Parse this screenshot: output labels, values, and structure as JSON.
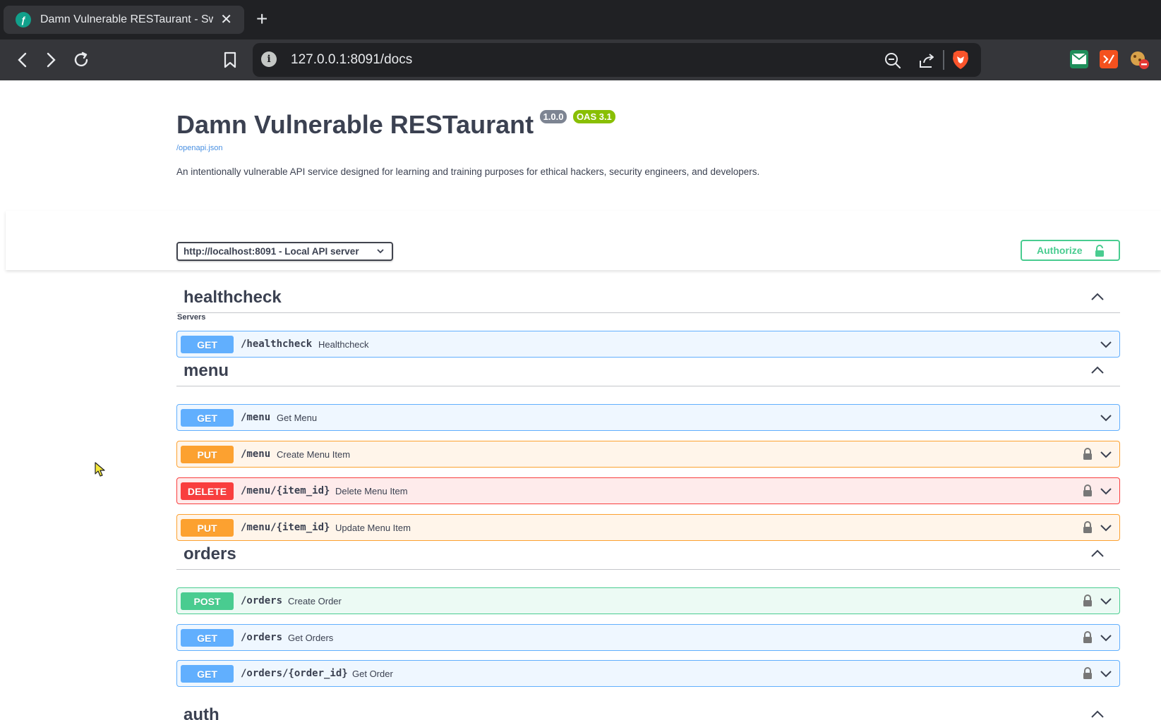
{
  "browser": {
    "tab_title": "Damn Vulnerable RESTaurant - Swagger UI",
    "url": "127.0.0.1:8091/docs"
  },
  "info": {
    "title": "Damn Vulnerable RESTaurant",
    "version": "1.0.0",
    "oas": "OAS 3.1",
    "spec_link": "/openapi.json",
    "description": "An intentionally vulnerable API service designed for learning and training purposes for ethical hackers, security engineers, and developers."
  },
  "servers": {
    "label": "Servers",
    "selected": "http://localhost:8091 - Local API server"
  },
  "authorize_label": "Authorize",
  "tags": [
    {
      "name": "healthcheck",
      "operations": [
        {
          "method": "GET",
          "path": "/healthcheck",
          "summary": "Healthcheck",
          "locked": false
        }
      ]
    },
    {
      "name": "menu",
      "operations": [
        {
          "method": "GET",
          "path": "/menu",
          "summary": "Get Menu",
          "locked": false
        },
        {
          "method": "PUT",
          "path": "/menu",
          "summary": "Create Menu Item",
          "locked": true
        },
        {
          "method": "DELETE",
          "path": "/menu/{item_id}",
          "summary": "Delete Menu Item",
          "locked": true
        },
        {
          "method": "PUT",
          "path": "/menu/{item_id}",
          "summary": "Update Menu Item",
          "locked": true
        }
      ]
    },
    {
      "name": "orders",
      "operations": [
        {
          "method": "POST",
          "path": "/orders",
          "summary": "Create Order",
          "locked": true
        },
        {
          "method": "GET",
          "path": "/orders",
          "summary": "Get Orders",
          "locked": true
        },
        {
          "method": "GET",
          "path": "/orders/{order_id}",
          "summary": "Get Order",
          "locked": true
        }
      ]
    },
    {
      "name": "auth",
      "operations": []
    }
  ]
}
